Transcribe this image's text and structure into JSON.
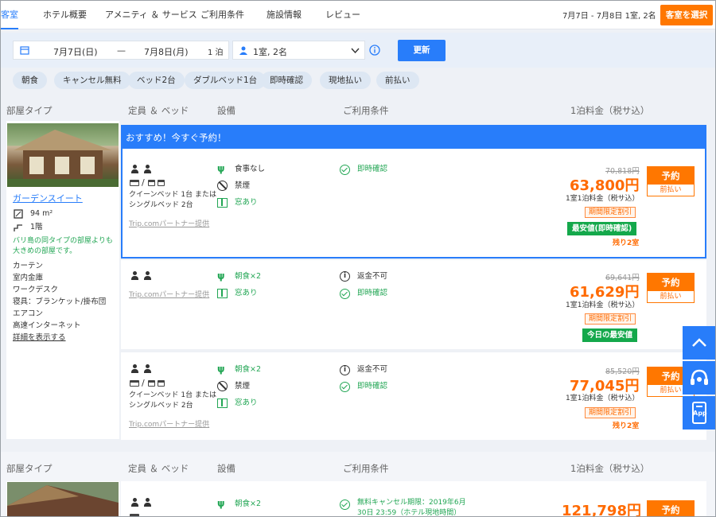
{
  "nav": {
    "tabs": [
      "客室",
      "ホテル概要",
      "アメニティ ＆ サービス",
      "ご利用条件",
      "施設情報",
      "レビュー"
    ],
    "summary": "7月7日 - 7月8日 1室, 2名",
    "select_room": "客室を選択"
  },
  "search": {
    "checkin": "7月7日(日)",
    "dash": "—",
    "checkout": "7月8日(月)",
    "nights": "1 泊",
    "guests": "1室, 2名",
    "update": "更新"
  },
  "filters": [
    "朝食",
    "キャンセル無料",
    "ベッド2台",
    "ダブルベッド1台",
    "即時確認",
    "現地払い",
    "前払い"
  ],
  "headers": {
    "room_type": "部屋タイプ",
    "capacity": "定員 ＆ ベッド",
    "facilities": "設備",
    "conditions": "ご利用条件",
    "price": "1泊料金（税サ込）"
  },
  "room1": {
    "name": "ガーデンスイート",
    "area": "94 m²",
    "floor": "1階",
    "note": "バリ島の同タイプの部屋よりも大きめの部屋です。",
    "amenities": [
      "カーテン",
      "室内金庫",
      "ワークデスク",
      "寝具：ブランケット/掛布団",
      "エアコン",
      "高速インターネット"
    ],
    "details_link": "詳細を表示する",
    "promo_banner": "おすすめ！今すぐ予約！",
    "offers": [
      {
        "bed_text": "クイーンベッド 1台 または\nシングルベッド 2台",
        "provider": "Trip.comパートナー提供",
        "facilities": [
          "食事なし",
          "禁煙",
          "窓あり"
        ],
        "conditions": [
          "即時確認"
        ],
        "old_price": "70,818円",
        "price": "63,800円",
        "price_note": "1室1泊料金（税サ込）",
        "deal": "期間限定割引",
        "best": "最安値(即時確認)",
        "remaining": "残り2室",
        "book": "予約",
        "pay": "前払い"
      },
      {
        "provider": "Trip.comパートナー提供",
        "facilities": [
          "朝食×2",
          "窓あり"
        ],
        "conditions": [
          "返金不可",
          "即時確認"
        ],
        "old_price": "69,641円",
        "price": "61,629円",
        "price_note": "1室1泊料金（税サ込）",
        "deal": "期間限定割引",
        "best": "今日の最安値",
        "book": "予約",
        "pay": "前払い"
      },
      {
        "bed_text": "クイーンベッド 1台 または\nシングルベッド 2台",
        "provider": "Trip.comパートナー提供",
        "facilities": [
          "朝食×2",
          "禁煙",
          "窓あり"
        ],
        "conditions": [
          "返金不可",
          "即時確認"
        ],
        "old_price": "85,520円",
        "price": "77,045円",
        "price_note": "1室1泊料金（税サ込）",
        "deal": "期間限定割引",
        "remaining": "残り2室",
        "book": "予約",
        "pay": "前払い"
      }
    ]
  },
  "room2": {
    "facility": "朝食×2",
    "condition": "無料キャンセル期限：2019年6月\n30日 23:59（ホテル現地時間）",
    "price": "121,798円",
    "book": "予約"
  },
  "float": {
    "app": "App"
  }
}
